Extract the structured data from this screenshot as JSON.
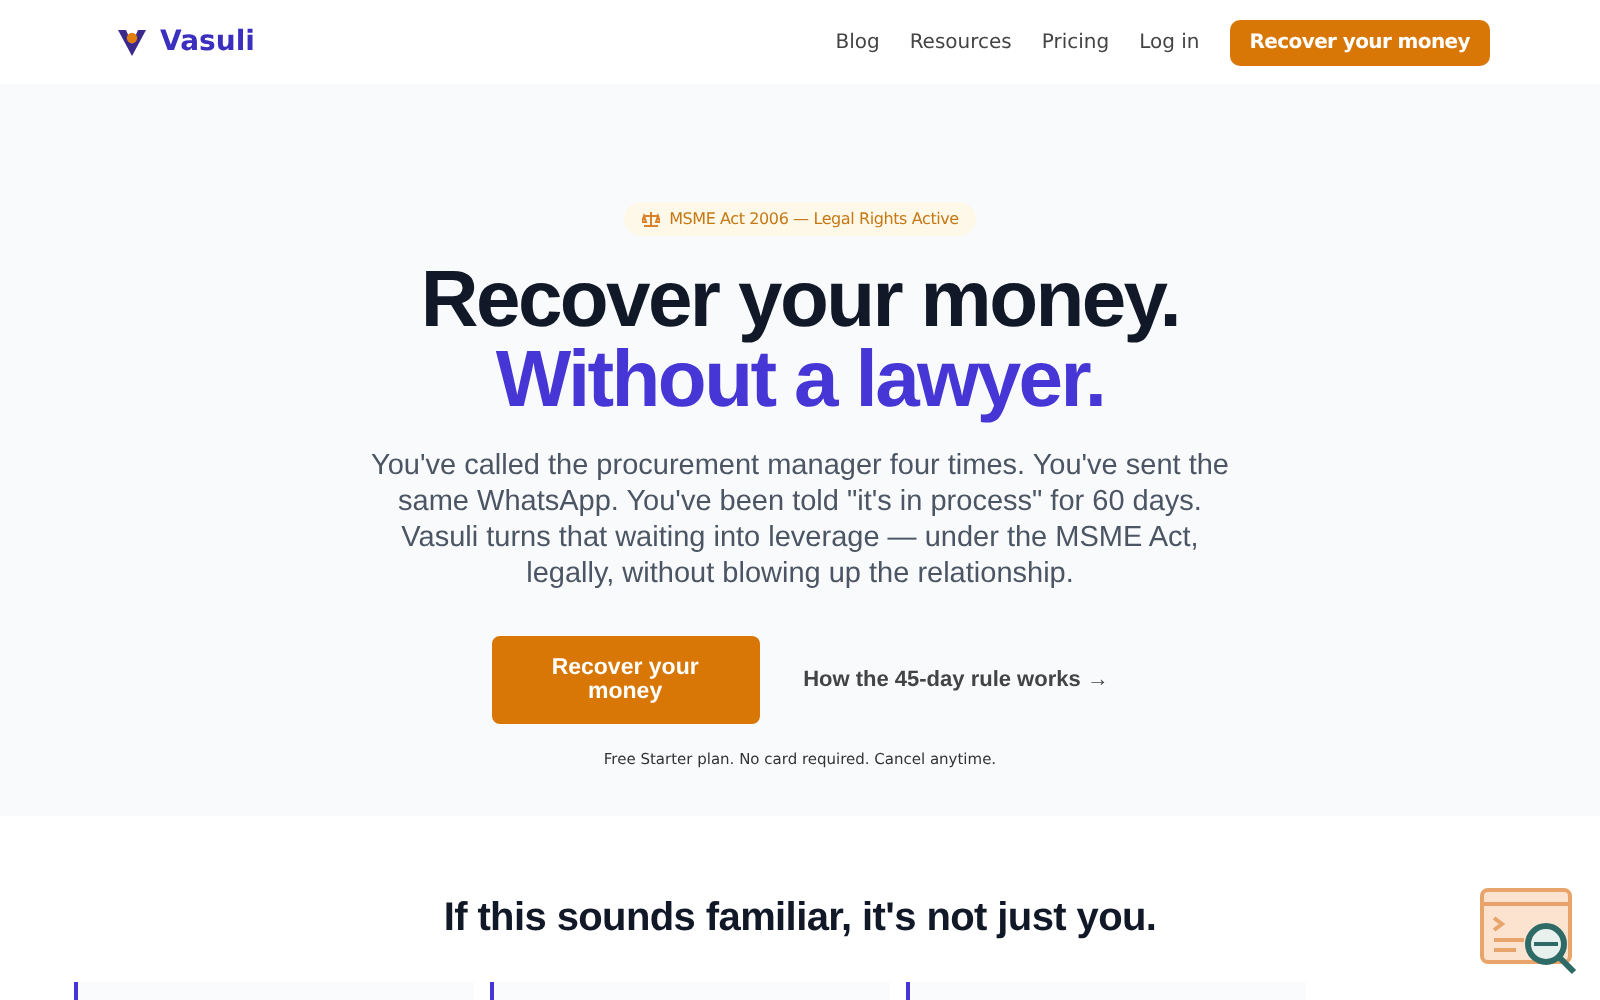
{
  "header": {
    "brand": "Vasuli",
    "nav": [
      "Blog",
      "Resources",
      "Pricing",
      "Log in"
    ],
    "cta": "Recover your money"
  },
  "hero": {
    "badge": "MSME Act 2006 — Legal Rights Active",
    "title_line_1": "Recover your money.",
    "title_line_2": "Without a lawyer.",
    "body": "You've called the procurement manager four times. You've sent the same WhatsApp. You've been told \"it's in process\" for 60 days. Vasuli turns that waiting into leverage — under the MSME Act, legally, without blowing up the relationship.",
    "primary_button": "Recover your money",
    "secondary_link": "How the 45-day rule works →",
    "note": "Free Starter plan. No card required. Cancel anytime."
  },
  "section": {
    "heading": "If this sounds familiar, it's not just you.",
    "cards": [
      {
        "kind": "card"
      },
      {
        "kind": "card"
      },
      {
        "kind": "card"
      }
    ]
  }
}
